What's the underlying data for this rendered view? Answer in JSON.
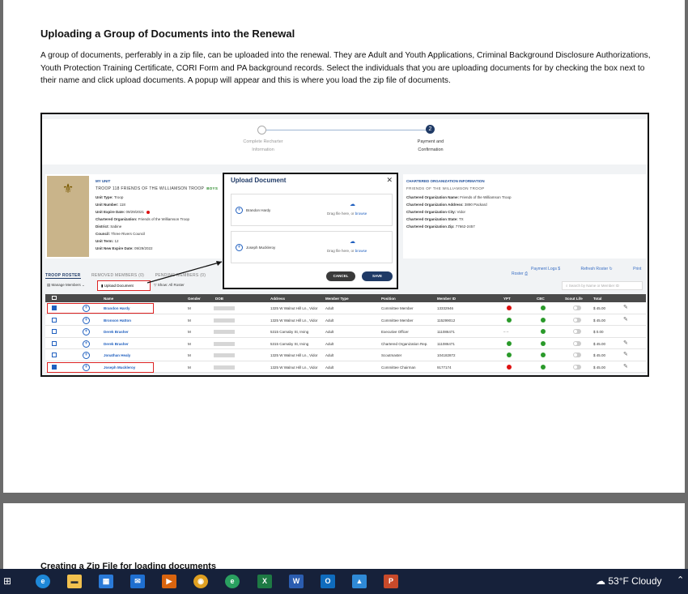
{
  "document": {
    "heading": "Uploading a Group of Documents into the Renewal",
    "paragraph": "A group of documents, perferably in a zip file,  can be uploaded into the renewal. They are Adult and Youth Applications, Criminal Background Disclosure Authorizations, Youth Protection Training Certificate, CORI Form and PA background records.  Select the individuals that you are uploading documents for by checking the box next to their name and click upload documents.  A popup will appear and this is where you load the zip file of documents.",
    "next_heading": "Creating a Zip File for loading documents"
  },
  "stepper": {
    "step1_label": "Complete Recharter Information",
    "step2_number": "2",
    "step2_label": "Payment and Confirmation"
  },
  "unit": {
    "header": "MY UNIT",
    "name": "TROOP 118 FRIENDS OF THE WILLIAMSON TROOP",
    "badge": "BOYS",
    "fields": [
      {
        "label": "Unit Type:",
        "value": "Troop"
      },
      {
        "label": "Unit Number:",
        "value": "118"
      },
      {
        "label": "Unit Expire Date:",
        "value": "09/29/2021"
      },
      {
        "label": "Chartered Organization:",
        "value": "Friends of the Williamson Troop"
      },
      {
        "label": "District:",
        "value": "Sabine"
      },
      {
        "label": "Council:",
        "value": "Three Rivers Council"
      },
      {
        "label": "Unit Term:",
        "value": "12"
      },
      {
        "label": "Unit New Expire Date:",
        "value": "09/29/2022"
      }
    ]
  },
  "org": {
    "header": "CHARTERED ORGANIZATION INFORMATION",
    "name": "FRIENDS OF THE WILLIAMSON TROOP",
    "fields": [
      {
        "label": "Chartered Organization Name:",
        "value": "Friends of the Williamson Troop"
      },
      {
        "label": "Chartered Organization Address:",
        "value": "3890 Packard"
      },
      {
        "label": "Chartered Organization City:",
        "value": "Vidor"
      },
      {
        "label": "Chartered Organization State:",
        "value": "TX"
      },
      {
        "label": "Chartered Organization Zip:",
        "value": "77662-2457"
      }
    ]
  },
  "tabs": [
    "TROOP ROSTER",
    "REMOVED MEMBERS (0)",
    "PENDING MEMBERS (0)"
  ],
  "tools": [
    "Payment Logs",
    "Refresh Roster",
    "Print Roster"
  ],
  "actions": {
    "manage": "Manage Members",
    "upload": "Upload Document",
    "show": "Show: All Roster",
    "search_placeholder": "Search by Name or Member ID"
  },
  "table": {
    "headers": [
      "Name",
      "Gender",
      "DOB",
      "Address",
      "Member Type",
      "Position",
      "Member ID",
      "YPT",
      "CBC",
      "Scout Life",
      "Total"
    ],
    "rows": [
      {
        "checked": true,
        "name": "Brandon Hardy",
        "gender": "M",
        "address": "1325 W Walnut Hill Ln., Vidor",
        "type": "Adult",
        "position": "Committee Member",
        "id": "13332946",
        "ypt": "red",
        "total": "$ 45.00",
        "edit": true
      },
      {
        "checked": false,
        "name": "Bronson Hatton",
        "gender": "M",
        "address": "1325 W Walnut Hill Ln., Vidor",
        "type": "Adult",
        "position": "Committee Member",
        "id": "115299012",
        "ypt": "green",
        "total": "$ 45.00",
        "edit": true
      },
      {
        "checked": false,
        "name": "Derek Brasher",
        "gender": "M",
        "address": "5315 Carnaby St, Irving",
        "type": "Adult",
        "position": "Executive Officer",
        "id": "111086471",
        "ypt": "dash",
        "total": "$ 0.00",
        "edit": false
      },
      {
        "checked": false,
        "name": "Derek Brasher",
        "gender": "M",
        "address": "5315 Carnaby St, Irving",
        "type": "Adult",
        "position": "Chartered Organization Rep.",
        "id": "111086471",
        "ypt": "green",
        "total": "$ 45.00",
        "edit": true
      },
      {
        "checked": false,
        "name": "Jonathan Healy",
        "gender": "M",
        "address": "1325 W Walnut Hill Ln., Vidor",
        "type": "Adult",
        "position": "Scoutmaster",
        "id": "104182872",
        "ypt": "green",
        "total": "$ 45.00",
        "edit": true
      },
      {
        "checked": true,
        "name": "Joseph Muckleroy",
        "gender": "M",
        "address": "1325 W Walnut Hill Ln., Vidor",
        "type": "Adult",
        "position": "Committee Chairman",
        "id": "9177174",
        "ypt": "red",
        "total": "$ 45.00",
        "edit": true
      }
    ]
  },
  "popup": {
    "title": "Upload Document",
    "people": [
      "Brandon Hardy",
      "Joseph Muckleroy"
    ],
    "drop_text": "Drag file here, or",
    "browse": "browse",
    "cancel": "CANCEL",
    "save": "SAVE"
  },
  "taskbar": {
    "weather": "53°F  Cloudy",
    "apps": [
      "edge-icon",
      "file-explorer-icon",
      "store-icon",
      "mail-icon",
      "media-icon",
      "chrome-icon",
      "edge-dev-icon",
      "excel-icon",
      "word-icon",
      "outlook-icon",
      "photos-icon",
      "powerpoint-icon"
    ]
  },
  "colors": {
    "accent": "#1f3a66",
    "link": "#1f5fbf",
    "highlight": "#dd2222",
    "ok": "#2a9a2a",
    "warn": "#dd1111"
  }
}
